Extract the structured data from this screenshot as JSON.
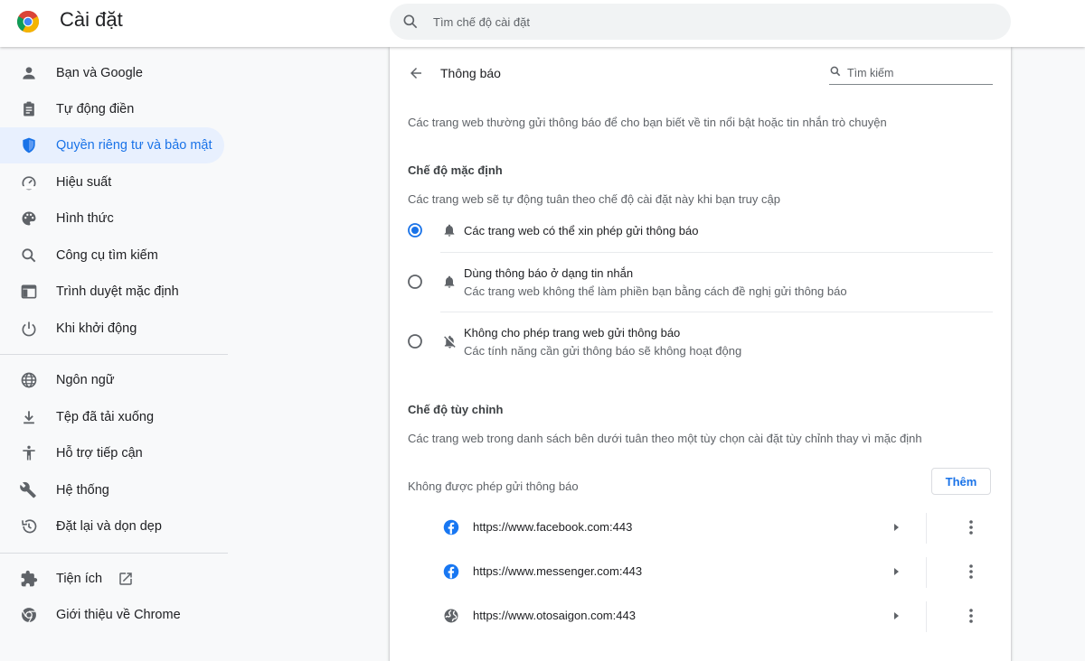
{
  "header": {
    "title": "Cài đặt",
    "search_placeholder": "Tìm chế độ cài đặt"
  },
  "sidebar": {
    "items": [
      {
        "label": "Bạn và Google",
        "icon": "person-icon"
      },
      {
        "label": "Tự động điền",
        "icon": "clipboard-icon"
      },
      {
        "label": "Quyền riêng tư và bảo mật",
        "icon": "shield-icon",
        "active": true
      },
      {
        "label": "Hiệu suất",
        "icon": "speedometer-icon"
      },
      {
        "label": "Hình thức",
        "icon": "palette-icon"
      },
      {
        "label": "Công cụ tìm kiếm",
        "icon": "search-icon"
      },
      {
        "label": "Trình duyệt mặc định",
        "icon": "browser-icon"
      },
      {
        "label": "Khi khởi động",
        "icon": "power-icon"
      },
      {
        "label": "Ngôn ngữ",
        "icon": "globe-icon"
      },
      {
        "label": "Tệp đã tải xuống",
        "icon": "download-icon"
      },
      {
        "label": "Hỗ trợ tiếp cận",
        "icon": "accessibility-icon"
      },
      {
        "label": "Hệ thống",
        "icon": "wrench-icon"
      },
      {
        "label": "Đặt lại và dọn dẹp",
        "icon": "restore-icon"
      },
      {
        "label": "Tiện ích",
        "icon": "puzzle-icon"
      },
      {
        "label": "Giới thiệu về Chrome",
        "icon": "chrome-icon"
      }
    ]
  },
  "page": {
    "title": "Thông báo",
    "search_placeholder": "Tìm kiếm",
    "intro": "Các trang web thường gửi thông báo để cho bạn biết về tin nổi bật hoặc tin nhắn trò chuyện",
    "default_section": {
      "title": "Chế độ mặc định",
      "description": "Các trang web sẽ tự động tuân theo chế độ cài đặt này khi bạn truy cập",
      "options": [
        {
          "label": "Các trang web có thể xin phép gửi thông báo",
          "description": "",
          "selected": true,
          "icon": "bell-icon"
        },
        {
          "label": "Dùng thông báo ở dạng tin nhắn",
          "description": "Các trang web không thể làm phiền bạn bằng cách đề nghị gửi thông báo",
          "selected": false,
          "icon": "bell-icon"
        },
        {
          "label": "Không cho phép trang web gửi thông báo",
          "description": "Các tính năng cần gửi thông báo sẽ không hoạt động",
          "selected": false,
          "icon": "bell-off-icon"
        }
      ]
    },
    "custom_section": {
      "title": "Chế độ tùy chỉnh",
      "description": "Các trang web trong danh sách bên dưới tuân theo một tùy chọn cài đặt tùy chỉnh thay vì mặc định",
      "blocked_label": "Không được phép gửi thông báo",
      "add_button": "Thêm",
      "sites": [
        {
          "url": "https://www.facebook.com:443",
          "icon": "facebook-icon"
        },
        {
          "url": "https://www.messenger.com:443",
          "icon": "facebook-icon"
        },
        {
          "url": "https://www.otosaigon.com:443",
          "icon": "globe-icon"
        }
      ]
    }
  },
  "colors": {
    "accent": "#1a73e8",
    "active_bg": "#e8f0fe",
    "icon_gray": "#5f6368",
    "facebook_blue": "#1877f2"
  }
}
